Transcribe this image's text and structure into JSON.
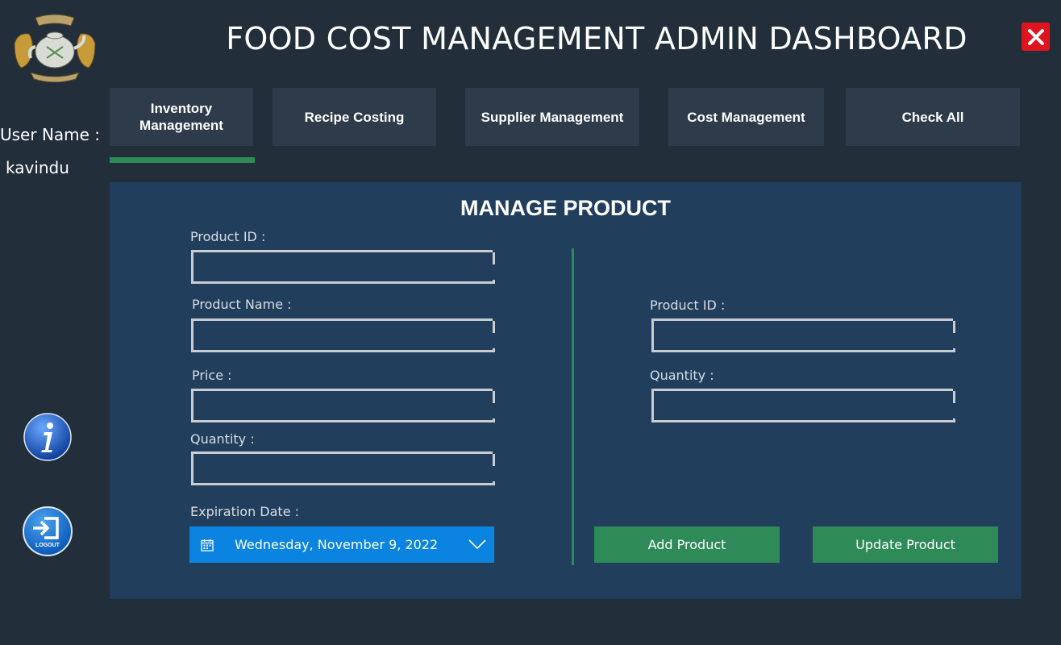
{
  "header": {
    "title": "FOOD COST MANAGEMENT ADMIN DASHBOARD",
    "logo_icon": "teapot-crest-logo",
    "close_icon": "close-icon"
  },
  "sidebar": {
    "user_label": "User Name :",
    "user_name": "kavindu",
    "info_icon": "info-icon",
    "logout_icon": "logout-icon",
    "logout_caption": "LOGOUT"
  },
  "tabs": [
    {
      "label": "Inventory\nManagement",
      "active": true
    },
    {
      "label": "Recipe Costing",
      "active": false
    },
    {
      "label": "Supplier Management",
      "active": false
    },
    {
      "label": "Cost Management",
      "active": false
    },
    {
      "label": "Check All",
      "active": false
    }
  ],
  "panel": {
    "title": "MANAGE PRODUCT",
    "left_form": {
      "product_id_label": "Product ID :",
      "product_id_value": "",
      "product_name_label": "Product Name :",
      "product_name_value": "",
      "price_label": "Price :",
      "price_value": "",
      "quantity_label": "Quantity :",
      "quantity_value": "",
      "expiration_label": "Expiration Date :",
      "expiration_value": "Wednesday, November 9, 2022"
    },
    "right_form": {
      "product_id_label": "Product ID :",
      "product_id_value": "",
      "quantity_label": "Quantity :",
      "quantity_value": ""
    },
    "add_button": "Add Product",
    "update_button": "Update Product"
  },
  "colors": {
    "background": "#232e3b",
    "tab": "#2e3b4a",
    "panel": "#213f5c",
    "accent_green": "#2e8b57",
    "date_blue": "#0a84e0",
    "close_red": "#e0141e"
  }
}
